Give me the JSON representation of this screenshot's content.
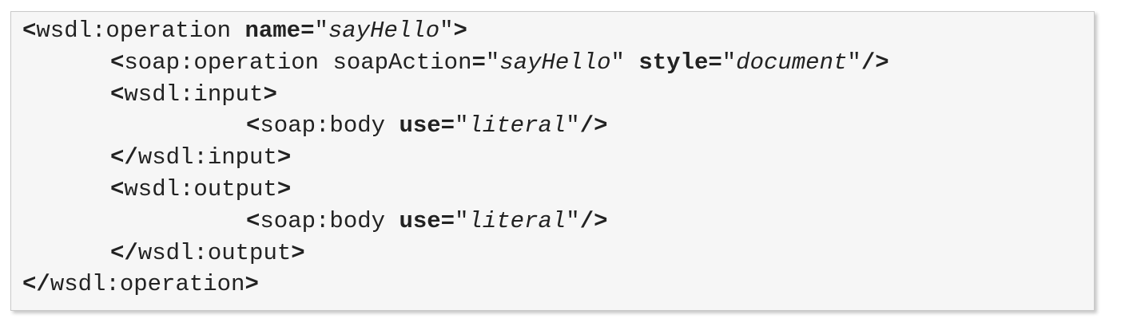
{
  "code": {
    "lines": [
      {
        "indent": 0,
        "tokens": [
          {
            "t": "<",
            "s": "b"
          },
          {
            "t": "wsdl:operation ",
            "s": ""
          },
          {
            "t": "name=",
            "s": "b"
          },
          {
            "t": "\"",
            "s": ""
          },
          {
            "t": "sayHello",
            "s": "i"
          },
          {
            "t": "\"",
            "s": ""
          },
          {
            "t": ">",
            "s": "b"
          }
        ]
      },
      {
        "indent": 1,
        "tokens": [
          {
            "t": "<",
            "s": "b"
          },
          {
            "t": "soap:operation soapAction",
            "s": ""
          },
          {
            "t": "=",
            "s": "b"
          },
          {
            "t": "\"",
            "s": ""
          },
          {
            "t": "sayHello",
            "s": "i"
          },
          {
            "t": "\" ",
            "s": ""
          },
          {
            "t": "style=",
            "s": "b"
          },
          {
            "t": "\"",
            "s": ""
          },
          {
            "t": "document",
            "s": "i"
          },
          {
            "t": "\"",
            "s": ""
          },
          {
            "t": "/>",
            "s": "b"
          }
        ]
      },
      {
        "indent": 1,
        "tokens": [
          {
            "t": "<",
            "s": "b"
          },
          {
            "t": "wsdl:input",
            "s": ""
          },
          {
            "t": ">",
            "s": "b"
          }
        ]
      },
      {
        "indent": 2,
        "tokens": [
          {
            "t": "<",
            "s": "b"
          },
          {
            "t": "soap:body ",
            "s": ""
          },
          {
            "t": "use=",
            "s": "b"
          },
          {
            "t": "\"",
            "s": ""
          },
          {
            "t": "literal",
            "s": "i"
          },
          {
            "t": "\"",
            "s": ""
          },
          {
            "t": "/>",
            "s": "b"
          }
        ]
      },
      {
        "indent": 1,
        "tokens": [
          {
            "t": "</",
            "s": "b"
          },
          {
            "t": "wsdl:input",
            "s": ""
          },
          {
            "t": ">",
            "s": "b"
          }
        ]
      },
      {
        "indent": 1,
        "tokens": [
          {
            "t": "<",
            "s": "b"
          },
          {
            "t": "wsdl:output",
            "s": ""
          },
          {
            "t": ">",
            "s": "b"
          }
        ]
      },
      {
        "indent": 2,
        "tokens": [
          {
            "t": "<",
            "s": "b"
          },
          {
            "t": "soap:body ",
            "s": ""
          },
          {
            "t": "use=",
            "s": "b"
          },
          {
            "t": "\"",
            "s": ""
          },
          {
            "t": "literal",
            "s": "i"
          },
          {
            "t": "\"",
            "s": ""
          },
          {
            "t": "/>",
            "s": "b"
          }
        ]
      },
      {
        "indent": 1,
        "tokens": [
          {
            "t": "</",
            "s": "b"
          },
          {
            "t": "wsdl:output",
            "s": ""
          },
          {
            "t": ">",
            "s": "b"
          }
        ]
      },
      {
        "indent": 0,
        "tokens": [
          {
            "t": "</",
            "s": "b"
          },
          {
            "t": "wsdl:operation",
            "s": ""
          },
          {
            "t": ">",
            "s": "b"
          }
        ]
      }
    ]
  }
}
